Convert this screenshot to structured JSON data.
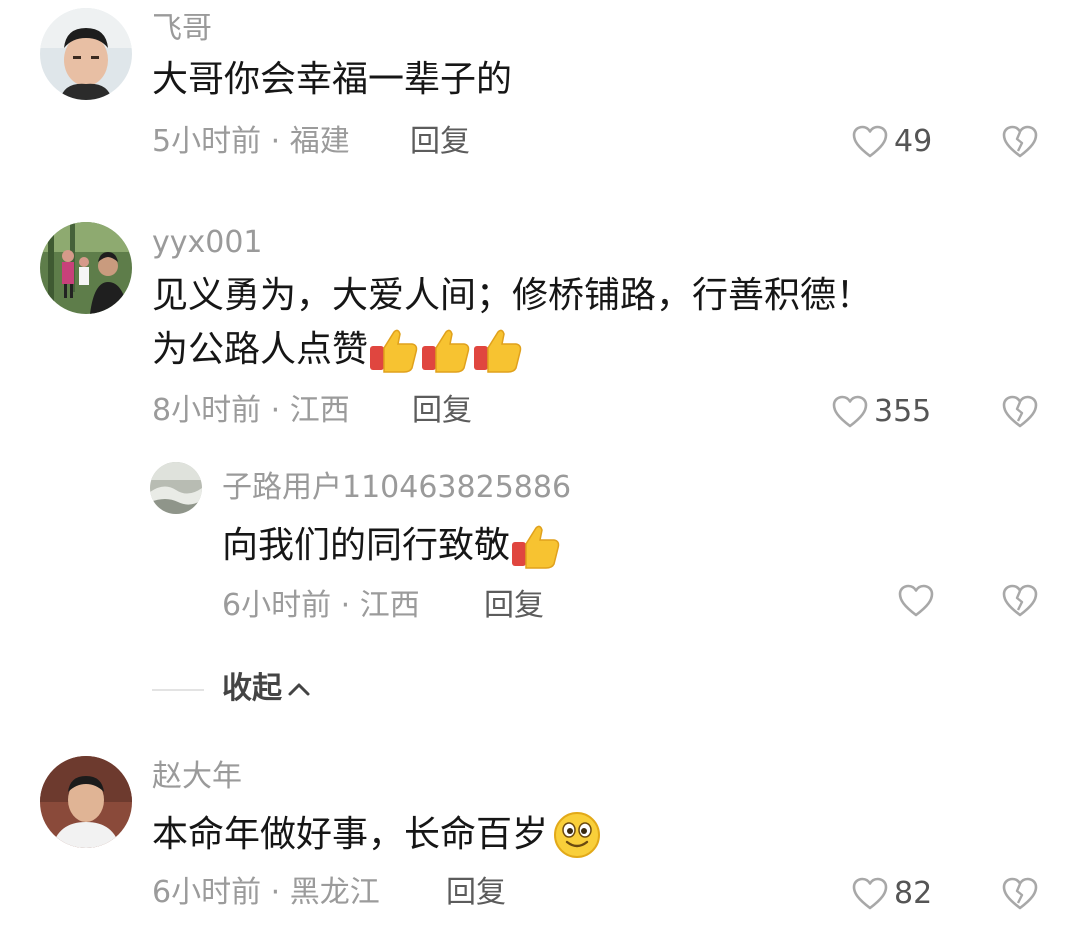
{
  "comments": [
    {
      "username": "飞哥",
      "text_line1": "大哥你会幸福一辈子的",
      "time": "5小时前",
      "location": "福建",
      "reply_label": "回复",
      "likes": "49"
    },
    {
      "username": "yyx001",
      "text_line1": "见义勇为，大爱人间；修桥铺路，行善积德！",
      "text_line2": "为公路人点赞",
      "emoji": "thumbs-up-icon",
      "emoji_count": 3,
      "time": "8小时前",
      "location": "江西",
      "reply_label": "回复",
      "likes": "355",
      "replies": [
        {
          "username": "子路用户110463825886",
          "text": "向我们的同行致敬",
          "emoji": "thumbs-up-icon",
          "time": "6小时前",
          "location": "江西",
          "reply_label": "回复",
          "likes": ""
        }
      ],
      "collapse_label": "收起"
    },
    {
      "username": "赵大年",
      "text_line1": "本命年做好事，长命百岁",
      "emoji": "smiley-icon",
      "time": "6小时前",
      "location": "黑龙江",
      "reply_label": "回复",
      "likes": "82"
    }
  ],
  "meta_separator": " · ",
  "colors": {
    "username": "#9a9a9a",
    "content": "#161616",
    "meta": "#9b9b9b",
    "icon": "#a8a8a8"
  }
}
